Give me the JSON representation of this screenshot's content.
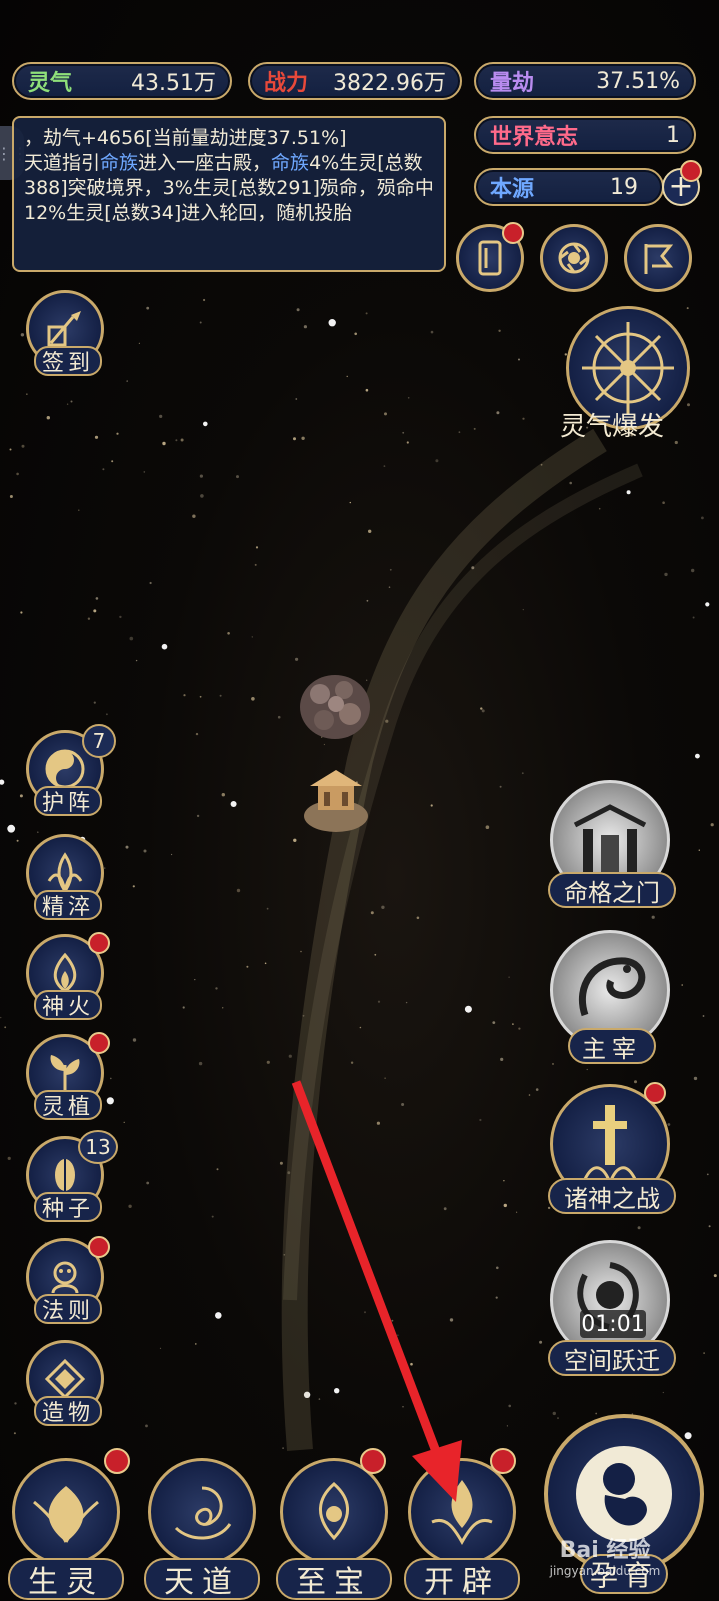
{
  "stats": {
    "lingqi": {
      "label": "灵气",
      "value": "43.51万",
      "color": "#8fe07a"
    },
    "zhanli": {
      "label": "战力",
      "value": "3822.96万",
      "color": "#e8493a"
    },
    "liangjie": {
      "label": "量劫",
      "value": "37.51%",
      "color": "#b98cf0"
    },
    "shijie": {
      "label": "世界意志",
      "value": "1",
      "color": "#ff6a8a"
    },
    "benyuan": {
      "label": "本源",
      "value": "19",
      "color": "#6fa8ff"
    }
  },
  "log": {
    "line1": "，劫气+4656[当前量劫进度37.51%]",
    "seg_a": "天道指引",
    "seg_b": "命族",
    "seg_c": "进入一座古殿，",
    "seg_d": "命族",
    "seg_e": "4%生灵[总数388]突破境界，3%生灵[总数291]殒命，殒命中12%生灵[总数34]进入轮回，随机投胎"
  },
  "top_right_icons": [
    "scroll-icon",
    "vortex-icon",
    "flag-icon"
  ],
  "qiandao": {
    "label": "签到"
  },
  "baofa": {
    "label": "灵气爆发"
  },
  "left_menu": [
    {
      "label": "护阵",
      "icon": "yin-yang-icon",
      "badge": "7"
    },
    {
      "label": "精淬",
      "icon": "lotus-flame-icon"
    },
    {
      "label": "神火",
      "icon": "fire-icon"
    },
    {
      "label": "灵植",
      "icon": "plant-icon"
    },
    {
      "label": "种子",
      "icon": "seed-icon",
      "badge": "13"
    },
    {
      "label": "法则",
      "icon": "law-icon"
    },
    {
      "label": "造物",
      "icon": "creation-icon"
    }
  ],
  "right_menu": [
    {
      "label": "命格之门",
      "icon": "gate-icon"
    },
    {
      "label": "主宰",
      "icon": "dragon-icon"
    },
    {
      "label": "诸神之战",
      "icon": "sword-icon"
    },
    {
      "label": "空间跃迁",
      "icon": "portal-icon",
      "timer": "01:01"
    }
  ],
  "bottom_nav": [
    {
      "label": "生灵",
      "icon": "phoenix-icon"
    },
    {
      "label": "天道",
      "icon": "swirl-icon"
    },
    {
      "label": "至宝",
      "icon": "treasure-icon"
    },
    {
      "label": "开辟",
      "icon": "flame-lotus-icon"
    }
  ],
  "corner": {
    "label": "孕育",
    "icon": "fetus-icon"
  },
  "watermark": {
    "text": "Bai 经验",
    "sub": "jingyan.baidu.com"
  },
  "colors": {
    "gold": "#c9a96a",
    "panel": "#17244a",
    "alert": "#c8202a",
    "arrow": "#e8242a"
  }
}
